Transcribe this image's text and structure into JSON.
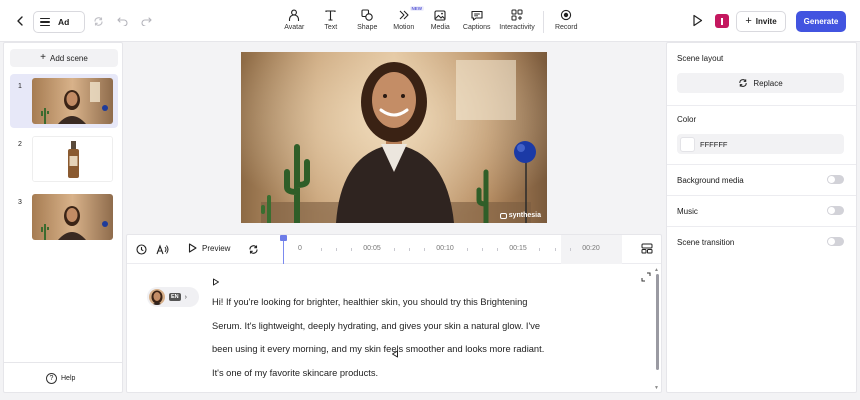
{
  "project": {
    "name": "Ad"
  },
  "toolbar": {
    "tools": [
      {
        "label": "Avatar",
        "icon": "avatar-icon"
      },
      {
        "label": "Text",
        "icon": "text-icon"
      },
      {
        "label": "Shape",
        "icon": "shape-icon"
      },
      {
        "label": "Motion",
        "icon": "motion-icon",
        "badge": "NEW"
      },
      {
        "label": "Media",
        "icon": "media-icon"
      },
      {
        "label": "Captions",
        "icon": "captions-icon"
      },
      {
        "label": "Interactivity",
        "icon": "interactivity-icon"
      },
      {
        "label": "Record",
        "icon": "record-icon"
      }
    ],
    "invite_label": "Invite",
    "generate_label": "Generate",
    "accent_color": "#4254e0",
    "user_chip_color": "#c4185f"
  },
  "scenes": {
    "add_label": "Add scene",
    "items": [
      {
        "number": "1",
        "active": true
      },
      {
        "number": "2",
        "active": false
      },
      {
        "number": "3",
        "active": false
      }
    ],
    "help_label": "Help"
  },
  "preview": {
    "watermark": "synthesia"
  },
  "timeline": {
    "preview_label": "Preview",
    "ticks": [
      "0",
      "00:05",
      "00:10",
      "00:15",
      "00:20"
    ]
  },
  "script": {
    "voice_language": "EN",
    "lines": [
      "Hi! If you're looking for brighter, healthier skin, you should try this Brightening",
      "Serum. It's lightweight, deeply hydrating, and gives your skin a natural glow. I've",
      "been using it every morning, and my skin feels smoother and looks more radiant.",
      "It's one of my favorite skincare products."
    ]
  },
  "properties": {
    "scene_layout_label": "Scene layout",
    "replace_label": "Replace",
    "color_label": "Color",
    "color_value": "FFFFFF",
    "background_media_label": "Background media",
    "background_media_on": false,
    "music_label": "Music",
    "music_on": false,
    "scene_transition_label": "Scene transition",
    "scene_transition_on": false
  }
}
